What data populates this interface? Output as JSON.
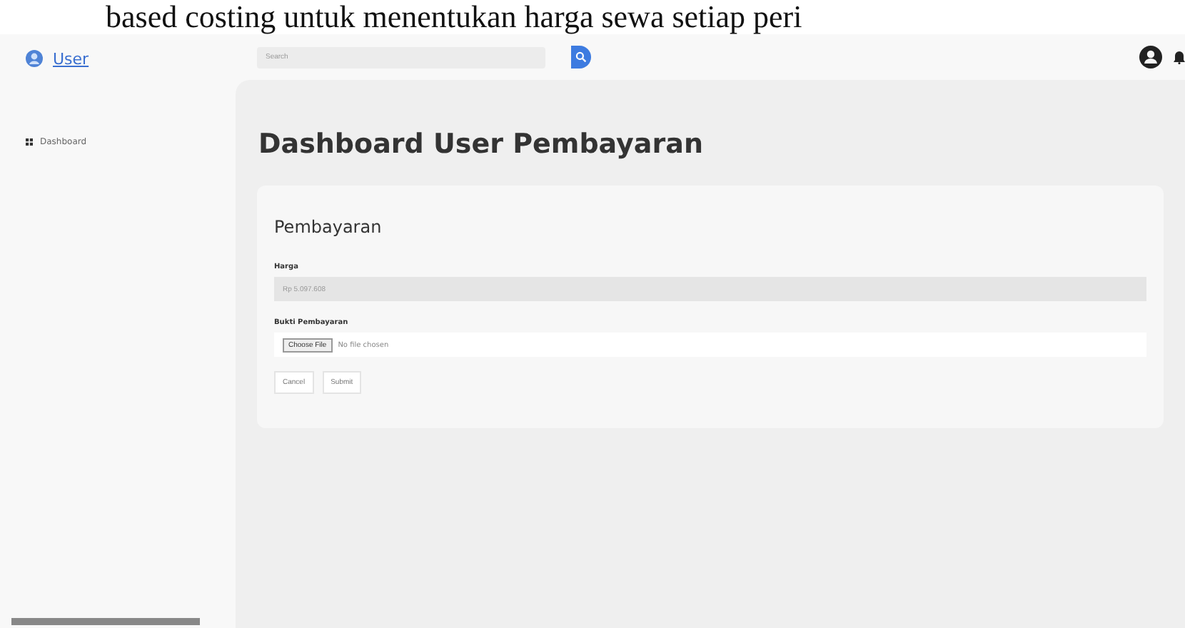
{
  "document_text": "based costing untuk menentukan harga sewa setiap peri",
  "brand": {
    "label": "User"
  },
  "sidebar": {
    "items": [
      {
        "label": "Dashboard",
        "selected": false
      }
    ]
  },
  "header": {
    "search": {
      "placeholder": "Search"
    }
  },
  "page_title": "Dashboard User Pembayaran",
  "card": {
    "title": "Pembayaran",
    "fields": [
      {
        "kind": "text",
        "label": "Harga",
        "value": "Rp 5.097.608",
        "disabled": true
      },
      {
        "kind": "file",
        "label": "Bukti Pembayaran",
        "button": "Choose File",
        "value": "No file chosen"
      }
    ],
    "buttons": [
      "Cancel",
      "Submit"
    ]
  }
}
